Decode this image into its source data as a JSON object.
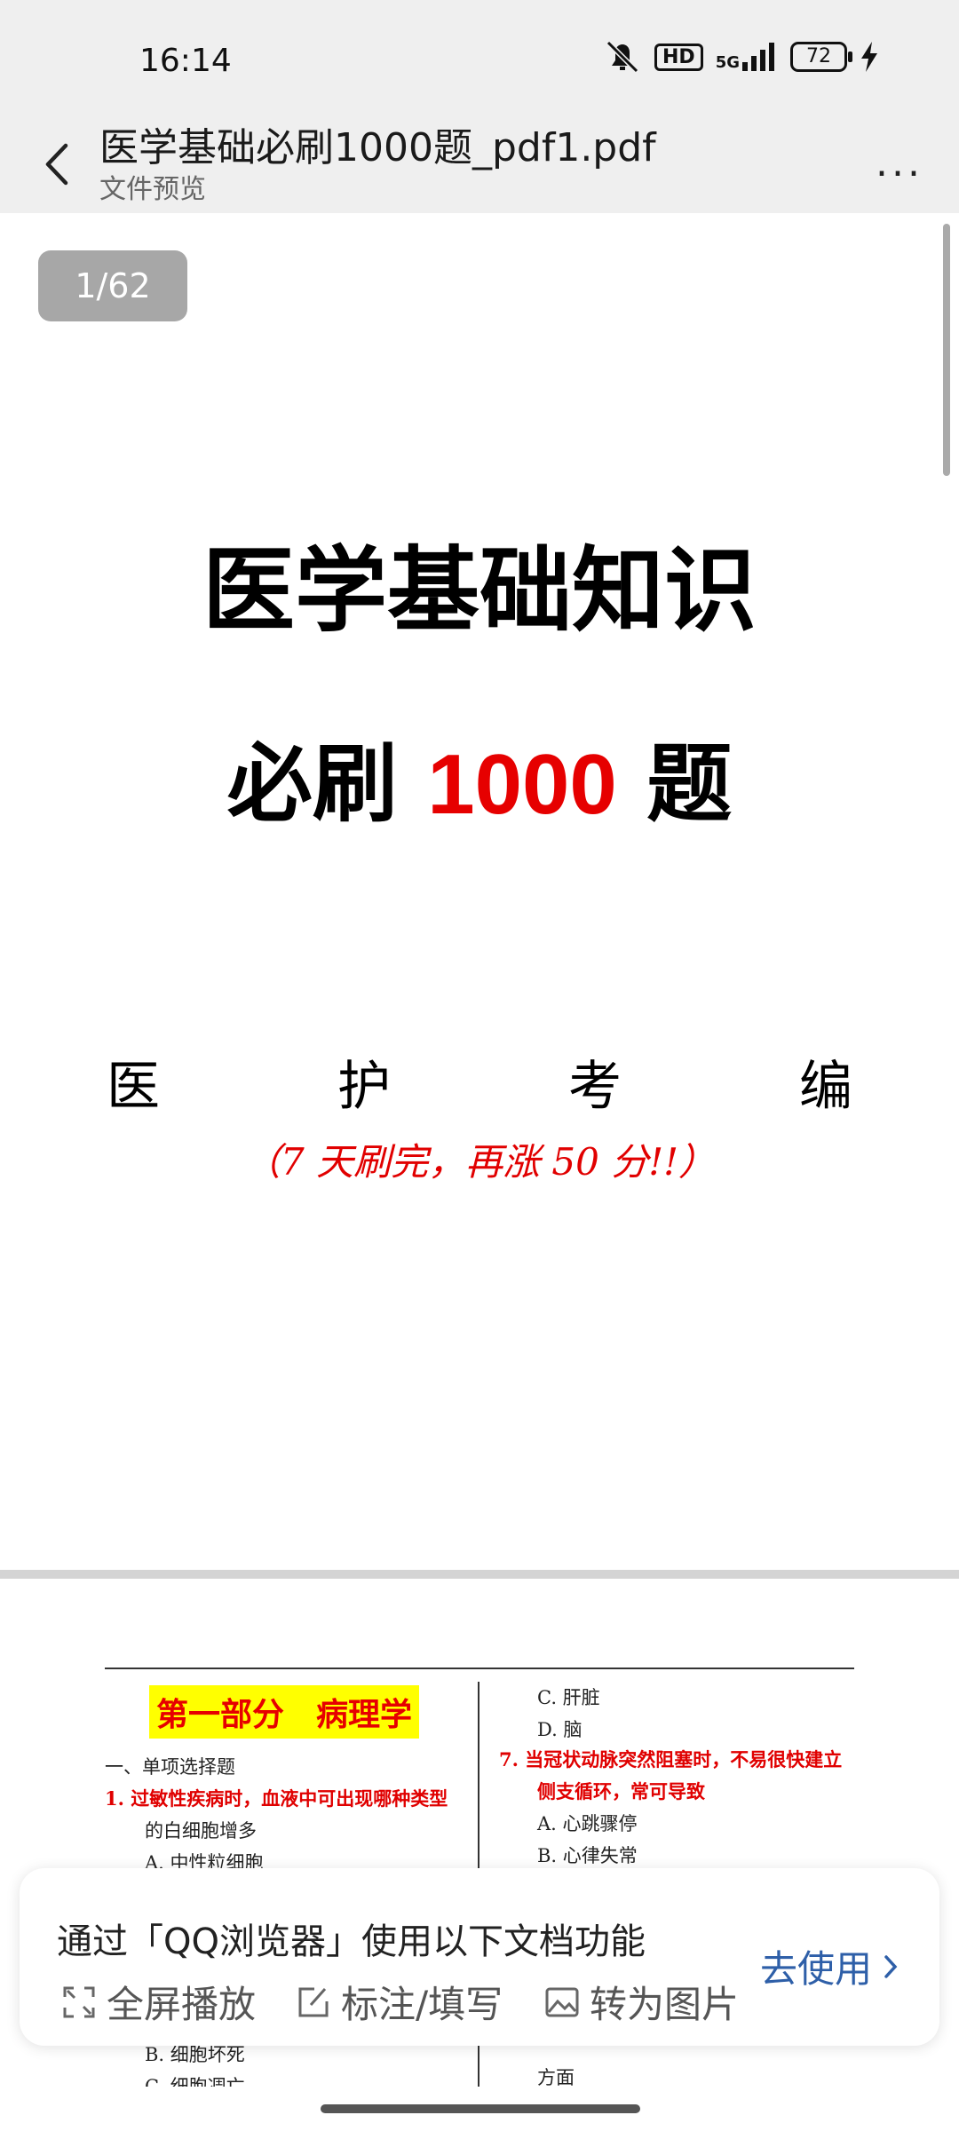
{
  "statusbar": {
    "time": "16:14",
    "network_hd": "HD",
    "network_gen": "5G",
    "battery": "72"
  },
  "header": {
    "title": "医学基础必刷1000题_pdf1.pdf",
    "subtitle": "文件预览",
    "more": "..."
  },
  "viewer": {
    "page_indicator": "1/62",
    "cover": {
      "title_line1": "医学基础知识",
      "title_line2_pre": "必刷 ",
      "title_line2_num": "1000",
      "title_line2_post": " 题",
      "authors": [
        "医",
        "护",
        "考",
        "编"
      ],
      "slogan": "（7 天刷完，再涨 50 分!!）"
    },
    "page2": {
      "section_title": "第一部分　病理学",
      "left_lines": [
        {
          "text": "一、单项选择题",
          "red": false
        },
        {
          "text": "1. 过敏性疾病时，血液中可出现哪种类型",
          "red": true
        },
        {
          "text": "的白细胞增多",
          "red": false
        },
        {
          "text": "A. 中性粒细胞",
          "red": false
        },
        {
          "text": "B. 细胞坏死",
          "red": false
        },
        {
          "text": "C. 细胞凋亡",
          "red": false
        }
      ],
      "right_lines": [
        {
          "text": "C. 肝脏",
          "red": false
        },
        {
          "text": "D. 脑",
          "red": false
        },
        {
          "text": "7. 当冠状动脉突然阻塞时，不易很快建立",
          "red": true
        },
        {
          "text": "侧支循环，常可导致",
          "red": true
        },
        {
          "text": "A. 心跳骤停",
          "red": false
        },
        {
          "text": "B. 心律失常",
          "red": false
        },
        {
          "text": "方面",
          "red": false
        }
      ]
    }
  },
  "promo": {
    "text": "通过「QQ浏览器」使用以下文档功能",
    "features": [
      {
        "label": "全屏播放",
        "icon": "fullscreen-icon"
      },
      {
        "label": "标注/填写",
        "icon": "edit-icon"
      },
      {
        "label": "转为图片",
        "icon": "image-icon"
      }
    ],
    "cta": "去使用"
  }
}
